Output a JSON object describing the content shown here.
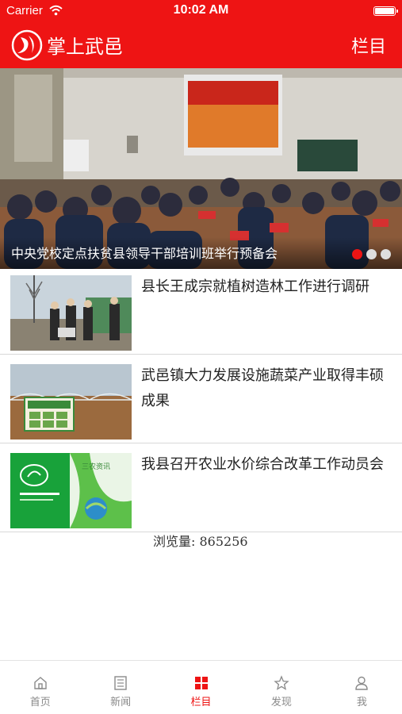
{
  "status_bar": {
    "carrier": "Carrier",
    "time": "10:02 AM"
  },
  "nav": {
    "title": "掌上武邑",
    "columns_label": "栏目"
  },
  "banner": {
    "caption": "中央党校定点扶贫县领导干部培训班举行预备会",
    "slide_count": 3,
    "active_slide": 1
  },
  "news": [
    {
      "title": "县长王成宗就植树造林工作进行调研",
      "thumbnail": "officials-tree-planting-photo"
    },
    {
      "title": "武邑镇大力发展设施蔬菜产业取得丰硕成果",
      "thumbnail": "greenhouse-billboard-photo"
    },
    {
      "title": "我县召开农业水价综合改革工作动员会",
      "thumbnail": "green-water-poster"
    }
  ],
  "view_count": {
    "label": "浏览量:",
    "value": "865256"
  },
  "tabs": [
    {
      "label": "首页",
      "icon": "home-icon",
      "active": false
    },
    {
      "label": "新闻",
      "icon": "news-icon",
      "active": false
    },
    {
      "label": "栏目",
      "icon": "grid-icon",
      "active": true
    },
    {
      "label": "发现",
      "icon": "star-icon",
      "active": false
    },
    {
      "label": "我",
      "icon": "user-icon",
      "active": false
    }
  ],
  "colors": {
    "brand_red": "#ee1414",
    "tab_inactive": "#8a8a8a"
  }
}
